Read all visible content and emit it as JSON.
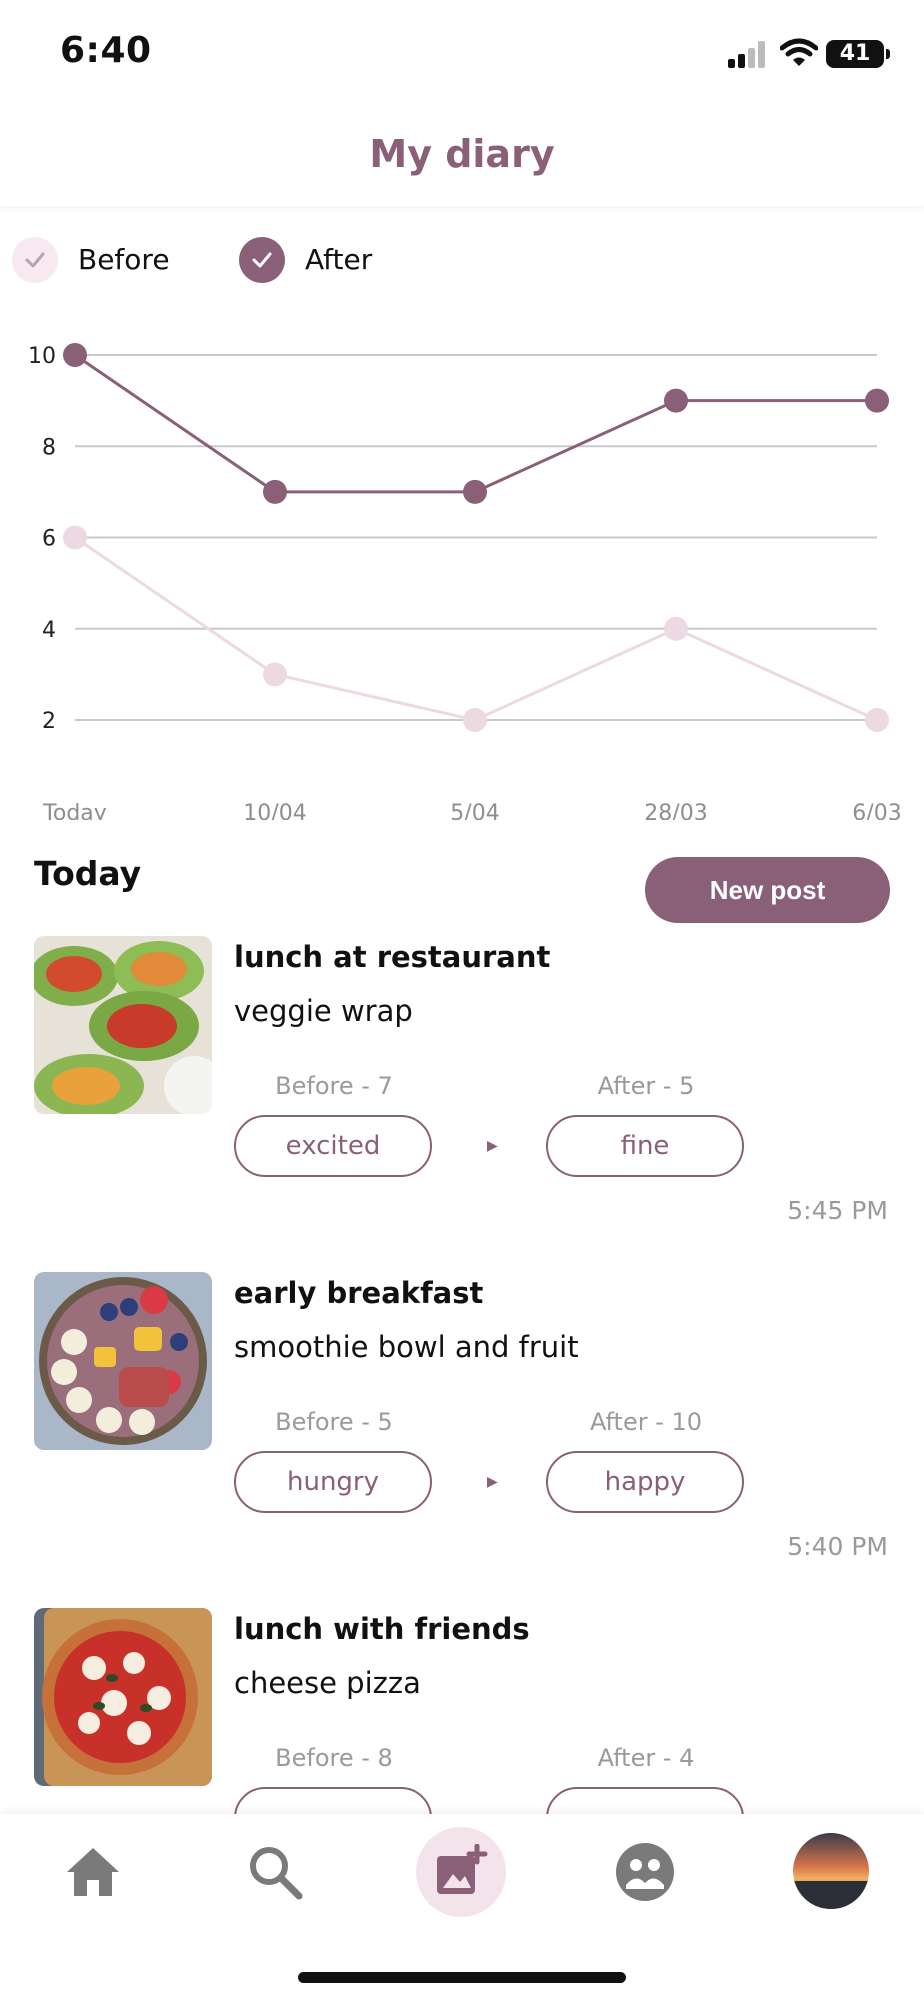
{
  "status_bar": {
    "time": "6:40",
    "battery": "41"
  },
  "header": {
    "title": "My diary"
  },
  "legend": {
    "before_label": "Before",
    "after_label": "After"
  },
  "colors": {
    "accent": "#8a5f78",
    "before_series": "#ecd9e1",
    "after_series": "#8a5f78",
    "muted_text": "#9a9a9a"
  },
  "chart_data": {
    "type": "line",
    "categories": [
      "Today",
      "10/04",
      "5/04",
      "28/03",
      "6/03"
    ],
    "series": [
      {
        "name": "Before",
        "values": [
          6,
          3,
          2,
          4,
          2
        ]
      },
      {
        "name": "After",
        "values": [
          10,
          7,
          7,
          9,
          9
        ]
      }
    ],
    "yticks": [
      "10",
      "8",
      "6",
      "4",
      "2"
    ],
    "ylim": [
      2,
      10
    ],
    "grid": true,
    "legend_position": "top-left"
  },
  "section": {
    "title": "Today",
    "new_post_label": "New post"
  },
  "entries": [
    {
      "title": "lunch at restaurant",
      "description": "veggie wrap",
      "before_score": "Before - 7",
      "after_score": "After - 5",
      "before_mood": "excited",
      "after_mood": "fine",
      "time": "5:45 PM"
    },
    {
      "title": "early breakfast",
      "description": "smoothie bowl and fruit",
      "before_score": "Before - 5",
      "after_score": "After - 10",
      "before_mood": "hungry",
      "after_mood": "happy",
      "time": "5:40 PM"
    },
    {
      "title": "lunch with friends",
      "description": "cheese pizza",
      "before_score": "Before - 8",
      "after_score": "After - 4",
      "before_mood": "",
      "after_mood": "",
      "time": ""
    }
  ],
  "nav": {
    "items": [
      {
        "icon": "home-icon"
      },
      {
        "icon": "search-icon"
      },
      {
        "icon": "add-photo-icon"
      },
      {
        "icon": "community-icon"
      },
      {
        "icon": "profile-avatar"
      }
    ]
  }
}
